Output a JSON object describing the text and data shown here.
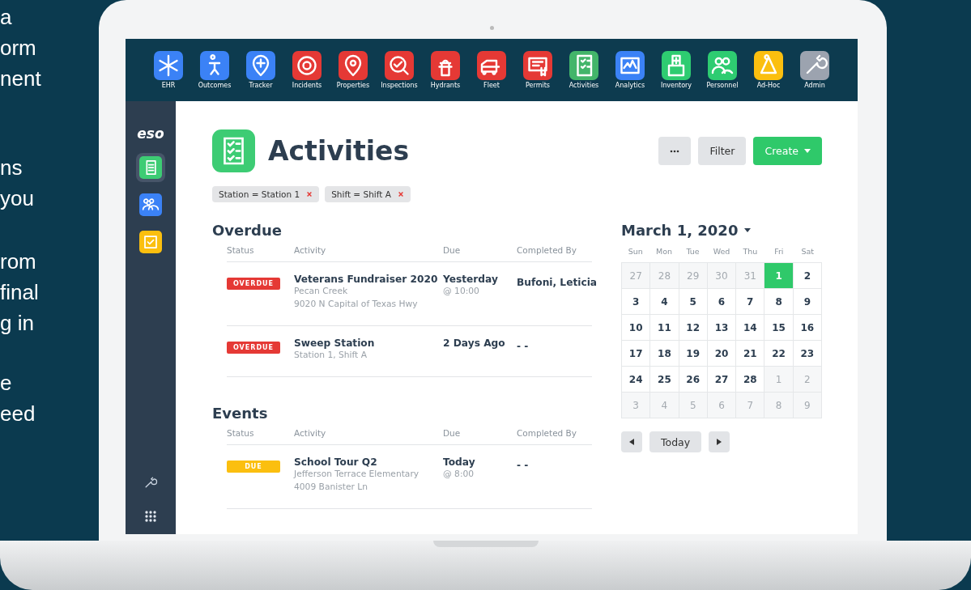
{
  "side_text": {
    "paragraphs": [
      [
        "a",
        "orm",
        "nent"
      ],
      [
        "ns",
        "you"
      ],
      [
        "rom",
        "final",
        "g in"
      ],
      [
        "e",
        "eed"
      ]
    ]
  },
  "apps": [
    {
      "label": "EHR",
      "color": "#3b82f6"
    },
    {
      "label": "Outcomes",
      "color": "#3b82f6"
    },
    {
      "label": "Tracker",
      "color": "#3b82f6"
    },
    {
      "label": "Incidents",
      "color": "#e53935"
    },
    {
      "label": "Properties",
      "color": "#e53935"
    },
    {
      "label": "Inspections",
      "color": "#e53935"
    },
    {
      "label": "Hydrants",
      "color": "#e53935"
    },
    {
      "label": "Fleet",
      "color": "#e53935"
    },
    {
      "label": "Permits",
      "color": "#e53935"
    },
    {
      "label": "Activities",
      "color": "#43b56a"
    },
    {
      "label": "Analytics",
      "color": "#3b82f6"
    },
    {
      "label": "Inventory",
      "color": "#2ecc71"
    },
    {
      "label": "Personnel",
      "color": "#2ecc71"
    },
    {
      "label": "Ad-Hoc",
      "color": "#fbbf0f"
    },
    {
      "label": "Admin",
      "color": "#9ca3af"
    }
  ],
  "sidebar": {
    "logo": "eso",
    "items": [
      {
        "color": "#3dcc74",
        "selected": true
      },
      {
        "color": "#3b82f6",
        "selected": false
      },
      {
        "color": "#fbbf0f",
        "selected": false
      }
    ]
  },
  "page": {
    "title": "Activities",
    "buttons": {
      "filter": "Filter",
      "create": "Create"
    },
    "filters": [
      "Station = Station 1",
      "Shift = Shift A"
    ]
  },
  "sections": [
    {
      "title": "Overdue",
      "columns": [
        "Status",
        "Activity",
        "Due",
        "Completed By"
      ],
      "rows": [
        {
          "status": "OVERDUE",
          "kind": "overdue",
          "activity": "Veterans Fundraiser 2020",
          "details": [
            "Pecan Creek",
            "9020 N Capital of Texas Hwy"
          ],
          "due": "Yesterday",
          "due_time": "@ 10:00",
          "completed_by": "Bufoni, Leticia"
        },
        {
          "status": "OVERDUE",
          "kind": "overdue",
          "activity": "Sweep Station",
          "details": [
            "Station 1, Shift A"
          ],
          "due": "2 Days Ago",
          "completed_by": "- -"
        }
      ]
    },
    {
      "title": "Events",
      "columns": [
        "Status",
        "Activity",
        "Due",
        "Completed By"
      ],
      "rows": [
        {
          "status": "DUE",
          "kind": "due",
          "activity": "School Tour Q2",
          "details": [
            "Jefferson Terrace Elementary",
            "4009 Banister Ln"
          ],
          "due": "Today",
          "due_time": "@ 8:00",
          "completed_by": "- -"
        }
      ]
    }
  ],
  "calendar": {
    "title": "March 1, 2020",
    "weekdays": [
      "Sun",
      "Mon",
      "Tue",
      "Wed",
      "Thu",
      "Fri",
      "Sat"
    ],
    "today": "Today",
    "days": [
      {
        "label": "27",
        "muted": true,
        "selected": false
      },
      {
        "label": "28",
        "muted": true,
        "selected": false
      },
      {
        "label": "29",
        "muted": true,
        "selected": false
      },
      {
        "label": "30",
        "muted": true,
        "selected": false
      },
      {
        "label": "31",
        "muted": true,
        "selected": false
      },
      {
        "label": "1",
        "muted": false,
        "selected": true
      },
      {
        "label": "2",
        "muted": false,
        "selected": false
      },
      {
        "label": "3",
        "muted": false,
        "selected": false
      },
      {
        "label": "4",
        "muted": false,
        "selected": false
      },
      {
        "label": "5",
        "muted": false,
        "selected": false
      },
      {
        "label": "6",
        "muted": false,
        "selected": false
      },
      {
        "label": "7",
        "muted": false,
        "selected": false
      },
      {
        "label": "8",
        "muted": false,
        "selected": false
      },
      {
        "label": "9",
        "muted": false,
        "selected": false
      },
      {
        "label": "10",
        "muted": false,
        "selected": false
      },
      {
        "label": "11",
        "muted": false,
        "selected": false
      },
      {
        "label": "12",
        "muted": false,
        "selected": false
      },
      {
        "label": "13",
        "muted": false,
        "selected": false
      },
      {
        "label": "14",
        "muted": false,
        "selected": false
      },
      {
        "label": "15",
        "muted": false,
        "selected": false
      },
      {
        "label": "16",
        "muted": false,
        "selected": false
      },
      {
        "label": "17",
        "muted": false,
        "selected": false
      },
      {
        "label": "18",
        "muted": false,
        "selected": false
      },
      {
        "label": "19",
        "muted": false,
        "selected": false
      },
      {
        "label": "20",
        "muted": false,
        "selected": false
      },
      {
        "label": "21",
        "muted": false,
        "selected": false
      },
      {
        "label": "22",
        "muted": false,
        "selected": false
      },
      {
        "label": "23",
        "muted": false,
        "selected": false
      },
      {
        "label": "24",
        "muted": false,
        "selected": false
      },
      {
        "label": "25",
        "muted": false,
        "selected": false
      },
      {
        "label": "26",
        "muted": false,
        "selected": false
      },
      {
        "label": "27",
        "muted": false,
        "selected": false
      },
      {
        "label": "28",
        "muted": false,
        "selected": false
      },
      {
        "label": "1",
        "muted": true,
        "selected": false
      },
      {
        "label": "2",
        "muted": true,
        "selected": false
      },
      {
        "label": "3",
        "muted": true,
        "selected": false
      },
      {
        "label": "4",
        "muted": true,
        "selected": false
      },
      {
        "label": "5",
        "muted": true,
        "selected": false
      },
      {
        "label": "6",
        "muted": true,
        "selected": false
      },
      {
        "label": "7",
        "muted": true,
        "selected": false
      },
      {
        "label": "8",
        "muted": true,
        "selected": false
      },
      {
        "label": "9",
        "muted": true,
        "selected": false
      }
    ]
  }
}
